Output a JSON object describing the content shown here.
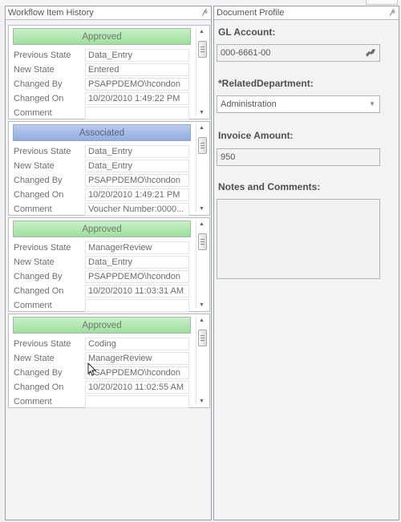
{
  "workflow_panel": {
    "title": "Workflow Item History",
    "cards": [
      {
        "state": "Approved",
        "state_type": "approved",
        "rows": [
          {
            "label": "Previous State",
            "value": "Data_Entry"
          },
          {
            "label": "New State",
            "value": "Entered"
          },
          {
            "label": "Changed By",
            "value": "PSAPPDEMO\\hcondon"
          },
          {
            "label": "Changed On",
            "value": "10/20/2010 1:49:22 PM"
          },
          {
            "label": "Comment",
            "value": ""
          }
        ]
      },
      {
        "state": "Associated",
        "state_type": "associated",
        "rows": [
          {
            "label": "Previous State",
            "value": "Data_Entry"
          },
          {
            "label": "New State",
            "value": "Data_Entry"
          },
          {
            "label": "Changed By",
            "value": "PSAPPDEMO\\hcondon"
          },
          {
            "label": "Changed On",
            "value": "10/20/2010 1:49:21 PM"
          },
          {
            "label": "Comment",
            "value": "Voucher Number:0000..."
          }
        ]
      },
      {
        "state": "Approved",
        "state_type": "approved",
        "rows": [
          {
            "label": "Previous State",
            "value": "ManagerReview"
          },
          {
            "label": "New State",
            "value": "Data_Entry"
          },
          {
            "label": "Changed By",
            "value": "PSAPPDEMO\\hcondon"
          },
          {
            "label": "Changed On",
            "value": "10/20/2010 11:03:31 AM"
          },
          {
            "label": "Comment",
            "value": ""
          }
        ]
      },
      {
        "state": "Approved",
        "state_type": "approved",
        "rows": [
          {
            "label": "Previous State",
            "value": "Coding"
          },
          {
            "label": "New State",
            "value": "ManagerReview"
          },
          {
            "label": "Changed By",
            "value": "PSAPPDEMO\\hcondon"
          },
          {
            "label": "Changed On",
            "value": "10/20/2010 11:02:55 AM"
          },
          {
            "label": "Comment",
            "value": ""
          }
        ]
      }
    ]
  },
  "profile_panel": {
    "title": "Document Profile",
    "gl_account": {
      "label": "GL Account:",
      "value": "000-6661-00"
    },
    "related_department": {
      "label": "*RelatedDepartment:",
      "value": "Administration"
    },
    "invoice_amount": {
      "label": "Invoice Amount:",
      "value": "950"
    },
    "notes": {
      "label": "Notes and Comments:",
      "value": ""
    }
  },
  "colors": {
    "approved": "#9ddf9d",
    "associated": "#8faee0",
    "panel_border": "#9aa0a6"
  }
}
